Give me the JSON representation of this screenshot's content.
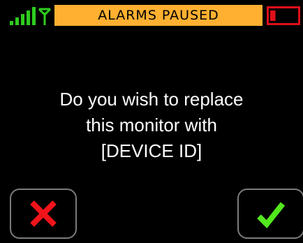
{
  "status_bar": {
    "banner_text": "ALARMS PAUSED",
    "signal_icon": "signal-strength-icon",
    "antenna_icon": "antenna-icon",
    "battery_icon": "battery-low-icon",
    "battery_level": 0.2
  },
  "dialog": {
    "message_lines": [
      "Do you wish to replace",
      "this monitor with",
      "[DEVICE ID]"
    ]
  },
  "buttons": {
    "cancel_icon": "red-x-icon",
    "confirm_icon": "green-check-icon"
  },
  "colors": {
    "background": "#000000",
    "banner": "#ffb031",
    "signal": "#2ecc1f",
    "battery": "#e0101a",
    "cancel": "#f0141a",
    "confirm": "#52e81d",
    "button_border": "#7b7b7b",
    "text": "#ffffff"
  }
}
